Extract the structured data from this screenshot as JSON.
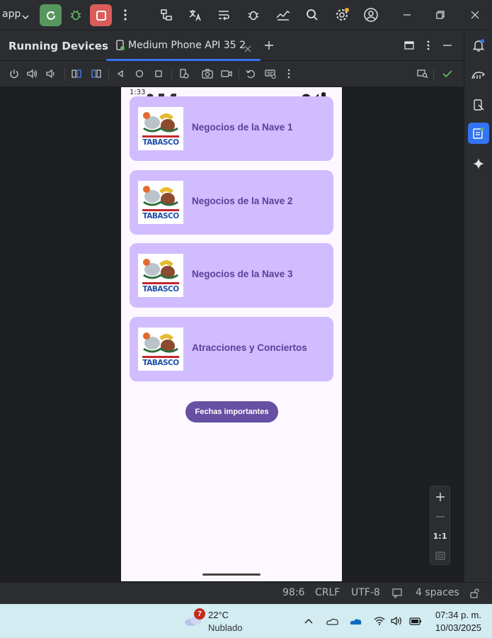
{
  "ide": {
    "project_selector": "app",
    "running_devices_title": "Running Devices",
    "device_tab_label": "Medium Phone API 35 2",
    "accent_color": "#3574f0"
  },
  "phone": {
    "status_time": "1:33",
    "cards": [
      {
        "label": "Negocios de la Nave 1",
        "logo_text": "TABASCO"
      },
      {
        "label": "Negocios de la Nave 2",
        "logo_text": "TABASCO"
      },
      {
        "label": "Negocios de la Nave 3",
        "logo_text": "TABASCO"
      },
      {
        "label": "Atracciones y Conciertos",
        "logo_text": "TABASCO"
      }
    ],
    "button_label": "Fechas importantes",
    "card_color": "#d0bcff",
    "button_color": "#6750a4"
  },
  "zoom_controls": {
    "one_to_one": "1:1"
  },
  "statusbar": {
    "position": "98:6",
    "line_endings": "CRLF",
    "encoding": "UTF-8",
    "indent": "4 spaces"
  },
  "taskbar": {
    "weather_badge": "7",
    "temperature": "22°C",
    "condition": "Nublado",
    "time": "07:34 p. m.",
    "date": "10/03/2025"
  }
}
